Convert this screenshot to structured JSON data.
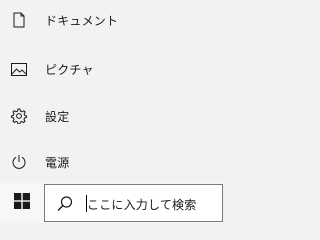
{
  "start_menu": {
    "items": [
      {
        "label": "ドキュメント",
        "icon": "document-icon"
      },
      {
        "label": "ピクチャ",
        "icon": "picture-icon"
      },
      {
        "label": "設定",
        "icon": "gear-icon"
      },
      {
        "label": "電源",
        "icon": "power-icon"
      }
    ]
  },
  "taskbar": {
    "start_icon": "windows-logo-icon",
    "search": {
      "icon": "search-icon",
      "placeholder": "ここに入力して検索"
    }
  },
  "colors": {
    "menu_background": "#f2f2f2",
    "taskbar_background": "#f7f7f7",
    "search_background": "#ffffff",
    "search_border": "#7a7a7a",
    "icon_color": "#1a1a1a"
  }
}
